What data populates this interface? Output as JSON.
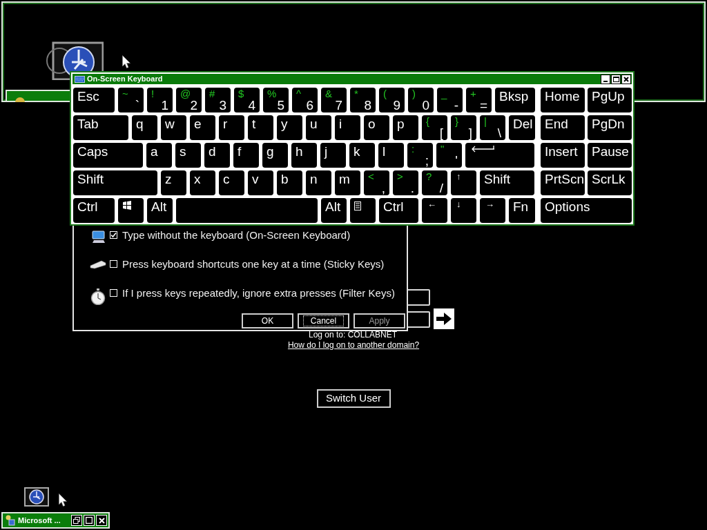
{
  "keyboard": {
    "title": "On-Screen Keyboard",
    "rows": [
      {
        "keys": [
          {
            "label": "Esc"
          },
          {
            "shift": "~",
            "label": "`"
          },
          {
            "shift": "!",
            "label": "1"
          },
          {
            "shift": "@",
            "label": "2"
          },
          {
            "shift": "#",
            "label": "3"
          },
          {
            "shift": "$",
            "label": "4"
          },
          {
            "shift": "%",
            "label": "5"
          },
          {
            "shift": "^",
            "label": "6"
          },
          {
            "shift": "&",
            "label": "7"
          },
          {
            "shift": "*",
            "label": "8"
          },
          {
            "shift": "(",
            "label": "9"
          },
          {
            "shift": ")",
            "label": "0"
          },
          {
            "shift": "_",
            "label": "-"
          },
          {
            "shift": "+",
            "label": "="
          },
          {
            "label": "Bksp"
          }
        ]
      },
      {
        "keys": [
          {
            "label": "Tab"
          },
          {
            "label": "q"
          },
          {
            "label": "w"
          },
          {
            "label": "e"
          },
          {
            "label": "r"
          },
          {
            "label": "t"
          },
          {
            "label": "y"
          },
          {
            "label": "u"
          },
          {
            "label": "i"
          },
          {
            "label": "o"
          },
          {
            "label": "p"
          },
          {
            "shift": "{",
            "label": "["
          },
          {
            "shift": "}",
            "label": "]"
          },
          {
            "shift": "|",
            "label": "\\"
          },
          {
            "label": "Del"
          }
        ]
      },
      {
        "keys": [
          {
            "label": "Caps"
          },
          {
            "label": "a"
          },
          {
            "label": "s"
          },
          {
            "label": "d"
          },
          {
            "label": "f"
          },
          {
            "label": "g"
          },
          {
            "label": "h"
          },
          {
            "label": "j"
          },
          {
            "label": "k"
          },
          {
            "label": "l"
          },
          {
            "shift": ":",
            "label": ";"
          },
          {
            "shift": "\"",
            "label": "'"
          },
          {
            "kind": "enter"
          }
        ]
      },
      {
        "keys": [
          {
            "label": "Shift"
          },
          {
            "label": "z"
          },
          {
            "label": "x"
          },
          {
            "label": "c"
          },
          {
            "label": "v"
          },
          {
            "label": "b"
          },
          {
            "label": "n"
          },
          {
            "label": "m"
          },
          {
            "shift": "<",
            "label": ","
          },
          {
            "shift": ">",
            "label": "."
          },
          {
            "shift": "?",
            "label": "/"
          },
          {
            "label": "↑",
            "kind": "arrow"
          },
          {
            "label": "Shift"
          }
        ]
      },
      {
        "keys": [
          {
            "label": "Ctrl"
          },
          {
            "kind": "windows"
          },
          {
            "label": "Alt"
          },
          {
            "kind": "space"
          },
          {
            "label": "Alt"
          },
          {
            "kind": "menu"
          },
          {
            "label": "Ctrl"
          },
          {
            "label": "←",
            "kind": "arrow"
          },
          {
            "label": "↓",
            "kind": "arrow"
          },
          {
            "label": "→",
            "kind": "arrow"
          },
          {
            "label": "Fn"
          }
        ]
      }
    ],
    "nav_rows": [
      {
        "keys": [
          {
            "label": "Home"
          },
          {
            "label": "PgUp"
          }
        ]
      },
      {
        "keys": [
          {
            "label": "End"
          },
          {
            "label": "PgDn"
          }
        ]
      },
      {
        "keys": [
          {
            "label": "Insert"
          },
          {
            "label": "Pause"
          }
        ]
      },
      {
        "keys": [
          {
            "label": "PrtScn"
          },
          {
            "label": "ScrLk"
          }
        ]
      },
      {
        "keys": [
          {
            "label": "Options"
          }
        ]
      }
    ]
  },
  "dialog": {
    "options": [
      {
        "label": "Type without the keyboard (On-Screen Keyboard)",
        "checked": true
      },
      {
        "label": "Press keyboard shortcuts one key at a time (Sticky Keys)",
        "checked": false
      },
      {
        "label": "If I press keys repeatedly, ignore extra presses (Filter Keys)",
        "checked": false
      }
    ],
    "buttons": [
      {
        "label": "OK",
        "disabled": false,
        "focused": false
      },
      {
        "label": "Cancel",
        "disabled": false,
        "focused": true
      },
      {
        "label": "Apply",
        "disabled": true,
        "focused": false
      }
    ]
  },
  "logon": {
    "domain": "Log on to: COLLABNET",
    "help_link": "How do I log on to another domain?",
    "switch_user": "Switch User"
  },
  "taskbar": {
    "title": "Microsoft ..."
  }
}
